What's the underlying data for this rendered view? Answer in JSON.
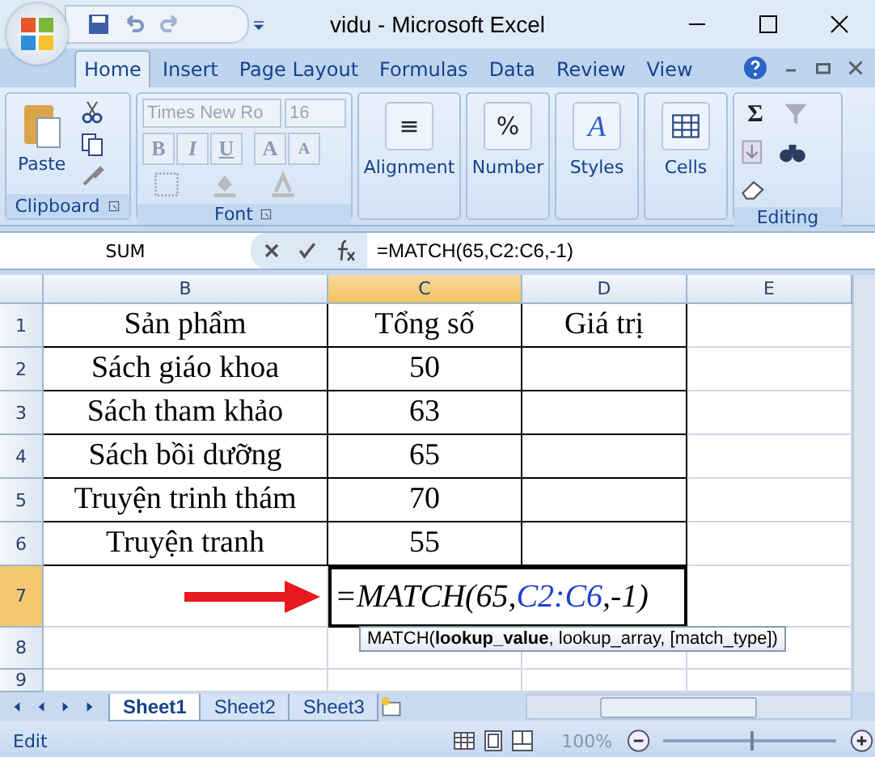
{
  "window": {
    "title": "vidu - Microsoft Excel"
  },
  "tabs": [
    {
      "label": "Home",
      "selected": true
    },
    {
      "label": "Insert",
      "selected": false
    },
    {
      "label": "Page Layout",
      "selected": false
    },
    {
      "label": "Formulas",
      "selected": false
    },
    {
      "label": "Data",
      "selected": false
    },
    {
      "label": "Review",
      "selected": false
    },
    {
      "label": "View",
      "selected": false
    }
  ],
  "ribbon": {
    "clipboard": {
      "paste": "Paste",
      "label": "Clipboard"
    },
    "font": {
      "name": "Times New Ro",
      "size": "16",
      "bold": "B",
      "italic": "I",
      "underline": "U",
      "grow": "A",
      "shrink": "A",
      "label": "Font"
    },
    "big_buttons": [
      {
        "kind": "align",
        "label": "Alignment",
        "glyph": "≡"
      },
      {
        "kind": "number",
        "label": "Number",
        "glyph": "%"
      },
      {
        "kind": "styles",
        "label": "Styles",
        "glyph": "A"
      },
      {
        "kind": "cells",
        "label": "Cells"
      }
    ],
    "editing": {
      "sum": "Σ",
      "label": "Editing"
    }
  },
  "formula_bar": {
    "name_box": "SUM",
    "formula": "=MATCH(65,C2:C6,-1)"
  },
  "columns": [
    {
      "label": "B",
      "selected": false
    },
    {
      "label": "C",
      "selected": true
    },
    {
      "label": "D",
      "selected": false
    },
    {
      "label": "E",
      "selected": false
    }
  ],
  "rows": [
    {
      "header": "1",
      "selected": false,
      "b": "Sản phẩm",
      "c": "Tổng số",
      "d": "Giá trị"
    },
    {
      "header": "2",
      "selected": false,
      "b": "Sách giáo khoa",
      "c": "50"
    },
    {
      "header": "3",
      "selected": false,
      "b": "Sách tham khảo",
      "c": "63"
    },
    {
      "header": "4",
      "selected": false,
      "b": "Sách bồi dưỡng",
      "c": "65"
    },
    {
      "header": "5",
      "selected": false,
      "b": "Truyện trinh thám",
      "c": "70"
    },
    {
      "header": "6",
      "selected": false,
      "b": "Truyện tranh",
      "c": "55"
    },
    {
      "header": "7",
      "selected": true,
      "formula": [
        {
          "kind": "plain",
          "text": "=MATCH(65,"
        },
        {
          "kind": "ref",
          "text": " C2:C6 "
        },
        {
          "kind": "plain",
          "text": ",-1)"
        }
      ]
    },
    {
      "header": "8",
      "selected": false
    },
    {
      "header": "9",
      "selected": false
    }
  ],
  "tooltip": "MATCH(**lookup_value**, lookup_array, [match_type])",
  "sheets": [
    {
      "label": "Sheet1",
      "selected": true
    },
    {
      "label": "Sheet2",
      "selected": false
    },
    {
      "label": "Sheet3",
      "selected": false
    }
  ],
  "status_bar": {
    "mode": "Edit",
    "zoom": "100%",
    "zoom_slider": {
      "level": 0.5
    }
  }
}
